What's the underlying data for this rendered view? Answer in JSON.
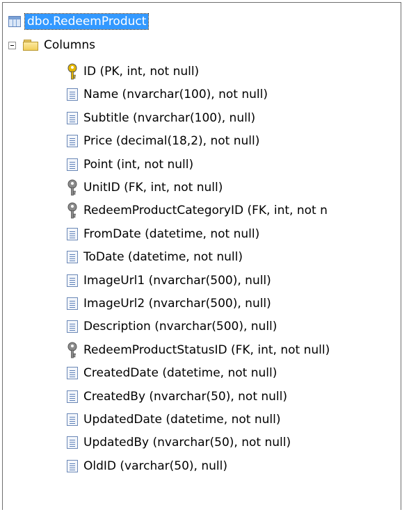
{
  "tree": {
    "table_node": {
      "label": "dbo.RedeemProduct",
      "icon": "table-icon"
    },
    "folder_node": {
      "label": "Columns",
      "icon": "folder-icon",
      "expander": "collapse"
    },
    "columns": [
      {
        "label": "ID (PK, int, not null)",
        "icon": "primary-key-icon"
      },
      {
        "label": "Name (nvarchar(100), not null)",
        "icon": "column-icon"
      },
      {
        "label": "Subtitle (nvarchar(100), null)",
        "icon": "column-icon"
      },
      {
        "label": "Price (decimal(18,2), not null)",
        "icon": "column-icon"
      },
      {
        "label": "Point (int, not null)",
        "icon": "column-icon"
      },
      {
        "label": "UnitID (FK, int, not null)",
        "icon": "foreign-key-icon"
      },
      {
        "label": "RedeemProductCategoryID (FK, int, not n",
        "icon": "foreign-key-icon"
      },
      {
        "label": "FromDate (datetime, not null)",
        "icon": "column-icon"
      },
      {
        "label": "ToDate (datetime, not null)",
        "icon": "column-icon"
      },
      {
        "label": "ImageUrl1 (nvarchar(500), null)",
        "icon": "column-icon"
      },
      {
        "label": "ImageUrl2 (nvarchar(500), null)",
        "icon": "column-icon"
      },
      {
        "label": "Description (nvarchar(500), null)",
        "icon": "column-icon"
      },
      {
        "label": "RedeemProductStatusID (FK, int, not null)",
        "icon": "foreign-key-icon"
      },
      {
        "label": "CreatedDate (datetime, not null)",
        "icon": "column-icon"
      },
      {
        "label": "CreatedBy (nvarchar(50), not null)",
        "icon": "column-icon"
      },
      {
        "label": "UpdatedDate (datetime, not null)",
        "icon": "column-icon"
      },
      {
        "label": "UpdatedBy (nvarchar(50), not null)",
        "icon": "column-icon"
      },
      {
        "label": "OldID (varchar(50), null)",
        "icon": "column-icon"
      }
    ]
  },
  "colors": {
    "selection": "#3399ff",
    "primary_key": "#e6b800",
    "foreign_key": "#8c8c8c"
  }
}
